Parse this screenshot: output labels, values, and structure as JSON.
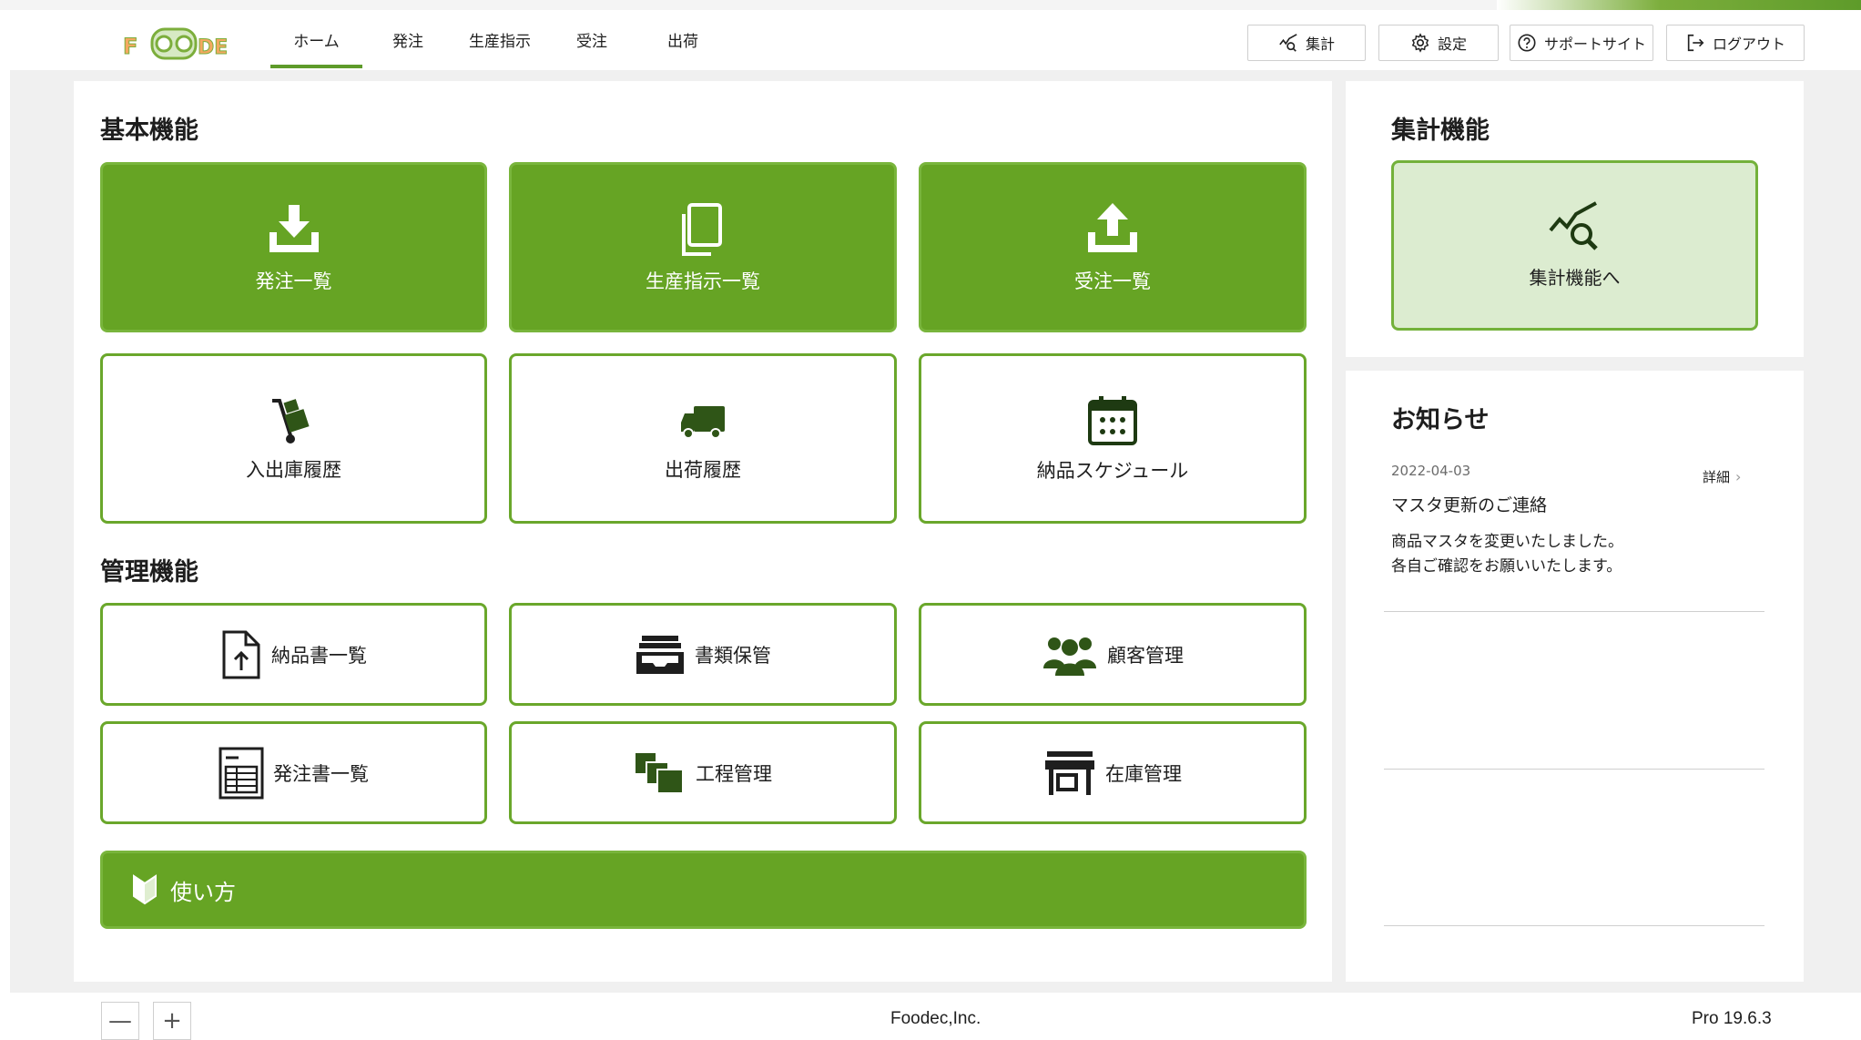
{
  "app": {
    "logo_text": "FOODEC",
    "brand_color": "#66a424",
    "accent_color": "#79b53c"
  },
  "nav": {
    "items": [
      {
        "label": "ホーム",
        "active": true
      },
      {
        "label": "発注",
        "active": false
      },
      {
        "label": "生産指示",
        "active": false
      },
      {
        "label": "受注",
        "active": false
      },
      {
        "label": "出荷",
        "active": false
      }
    ]
  },
  "header_buttons": {
    "aggregate": {
      "label": "集計",
      "icon": "chart-search-icon"
    },
    "settings": {
      "label": "設定",
      "icon": "gear-icon"
    },
    "support": {
      "label": "サポートサイト",
      "icon": "help-circle-icon"
    },
    "logout": {
      "label": "ログアウト",
      "icon": "logout-icon"
    }
  },
  "basic": {
    "title": "基本機能",
    "tiles": [
      {
        "label": "発注一覧",
        "icon": "download-icon"
      },
      {
        "label": "生産指示一覧",
        "icon": "copy-icon"
      },
      {
        "label": "受注一覧",
        "icon": "upload-icon"
      },
      {
        "label": "入出庫履歴",
        "icon": "hand-truck-icon"
      },
      {
        "label": "出荷履歴",
        "icon": "truck-icon"
      },
      {
        "label": "納品スケジュール",
        "icon": "calendar-icon"
      }
    ]
  },
  "management": {
    "title": "管理機能",
    "tiles": [
      {
        "label": "納品書一覧",
        "icon": "file-upload-icon"
      },
      {
        "label": "書類保管",
        "icon": "inbox-icon"
      },
      {
        "label": "顧客管理",
        "icon": "users-icon"
      },
      {
        "label": "発注書一覧",
        "icon": "spreadsheet-icon"
      },
      {
        "label": "工程管理",
        "icon": "stacked-squares-icon"
      },
      {
        "label": "在庫管理",
        "icon": "store-icon"
      }
    ]
  },
  "howto": {
    "label": "使い方",
    "icon": "beginner-mark-icon"
  },
  "aggregate": {
    "title": "集計機能",
    "tile_label": "集計機能へ",
    "icon": "chart-search-icon"
  },
  "news": {
    "title": "お知らせ",
    "items": [
      {
        "date": "2022-04-03",
        "detail_label": "詳細",
        "title": "マスタ更新のご連絡",
        "body_line1": "商品マスタを変更いたしました。",
        "body_line2": "各自ご確認をお願いいたします。"
      }
    ]
  },
  "footer": {
    "zoom_out": "—",
    "zoom_in": "+",
    "company": "Foodec,Inc.",
    "version": "Pro 19.6.3"
  }
}
